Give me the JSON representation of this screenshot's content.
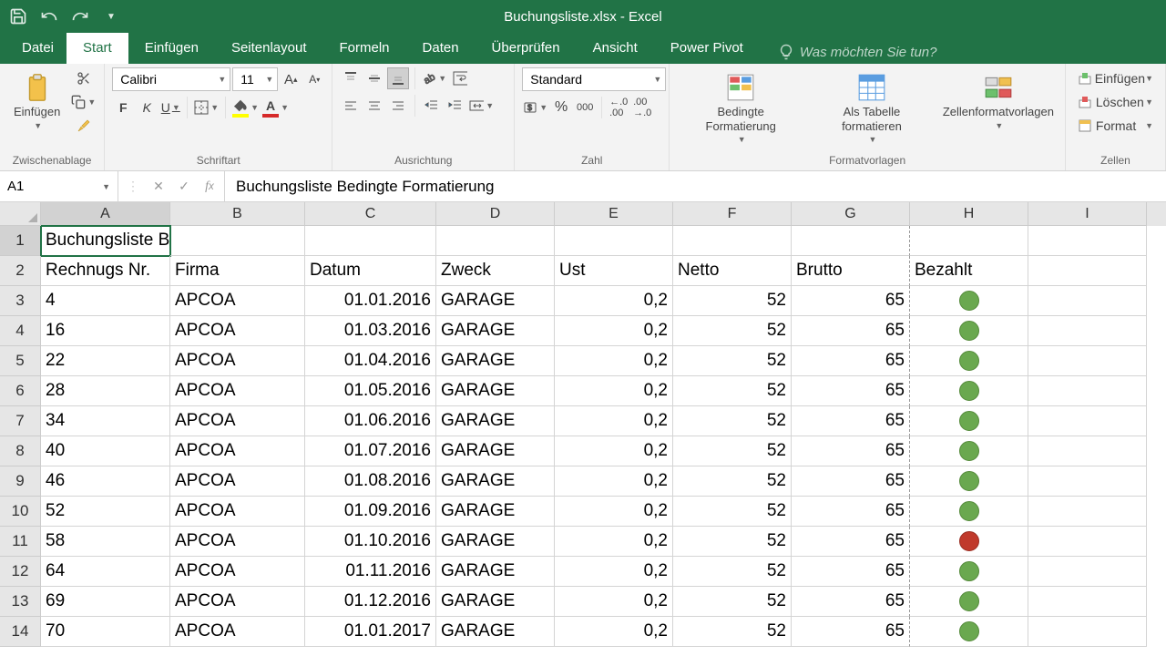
{
  "titlebar": {
    "title": "Buchungsliste.xlsx - Excel"
  },
  "tabs": {
    "file": "Datei",
    "home": "Start",
    "insert": "Einfügen",
    "page_layout": "Seitenlayout",
    "formulas": "Formeln",
    "data": "Daten",
    "review": "Überprüfen",
    "view": "Ansicht",
    "power_pivot": "Power Pivot",
    "tell_me": "Was möchten Sie tun?"
  },
  "ribbon": {
    "clipboard": {
      "label": "Zwischenablage",
      "paste": "Einfügen"
    },
    "font": {
      "label": "Schriftart",
      "name": "Calibri",
      "size": "11",
      "bold": "F",
      "italic": "K",
      "underline": "U"
    },
    "alignment": {
      "label": "Ausrichtung"
    },
    "number": {
      "label": "Zahl",
      "format": "Standard",
      "percent": "%",
      "thousand": "000"
    },
    "styles": {
      "label": "Formatvorlagen",
      "cond": "Bedingte Formatierung",
      "table": "Als Tabelle formatieren",
      "cell": "Zellenformatvorlagen"
    },
    "cells": {
      "label": "Zellen",
      "insert": "Einfügen",
      "delete": "Löschen",
      "format": "Format"
    }
  },
  "formula_bar": {
    "ref": "A1",
    "value": "Buchungsliste Bedingte Formatierung"
  },
  "columns": [
    "A",
    "B",
    "C",
    "D",
    "E",
    "F",
    "G",
    "H",
    "I"
  ],
  "headers": {
    "title": "Buchungsliste Bedingte Formatierung",
    "h": [
      "Rechnugs Nr.",
      "Firma",
      "Datum",
      "Zweck",
      "Ust",
      "Netto",
      "Brutto",
      "Bezahlt"
    ]
  },
  "rows": [
    {
      "nr": "4",
      "firma": "APCOA",
      "datum": "01.01.2016",
      "zweck": "GARAGE",
      "ust": "0,2",
      "netto": "52",
      "brutto": "65",
      "paid": "green"
    },
    {
      "nr": "16",
      "firma": "APCOA",
      "datum": "01.03.2016",
      "zweck": "GARAGE",
      "ust": "0,2",
      "netto": "52",
      "brutto": "65",
      "paid": "green"
    },
    {
      "nr": "22",
      "firma": "APCOA",
      "datum": "01.04.2016",
      "zweck": "GARAGE",
      "ust": "0,2",
      "netto": "52",
      "brutto": "65",
      "paid": "green"
    },
    {
      "nr": "28",
      "firma": "APCOA",
      "datum": "01.05.2016",
      "zweck": "GARAGE",
      "ust": "0,2",
      "netto": "52",
      "brutto": "65",
      "paid": "green"
    },
    {
      "nr": "34",
      "firma": "APCOA",
      "datum": "01.06.2016",
      "zweck": "GARAGE",
      "ust": "0,2",
      "netto": "52",
      "brutto": "65",
      "paid": "green"
    },
    {
      "nr": "40",
      "firma": "APCOA",
      "datum": "01.07.2016",
      "zweck": "GARAGE",
      "ust": "0,2",
      "netto": "52",
      "brutto": "65",
      "paid": "green"
    },
    {
      "nr": "46",
      "firma": "APCOA",
      "datum": "01.08.2016",
      "zweck": "GARAGE",
      "ust": "0,2",
      "netto": "52",
      "brutto": "65",
      "paid": "green"
    },
    {
      "nr": "52",
      "firma": "APCOA",
      "datum": "01.09.2016",
      "zweck": "GARAGE",
      "ust": "0,2",
      "netto": "52",
      "brutto": "65",
      "paid": "green"
    },
    {
      "nr": "58",
      "firma": "APCOA",
      "datum": "01.10.2016",
      "zweck": "GARAGE",
      "ust": "0,2",
      "netto": "52",
      "brutto": "65",
      "paid": "red"
    },
    {
      "nr": "64",
      "firma": "APCOA",
      "datum": "01.11.2016",
      "zweck": "GARAGE",
      "ust": "0,2",
      "netto": "52",
      "brutto": "65",
      "paid": "green"
    },
    {
      "nr": "69",
      "firma": "APCOA",
      "datum": "01.12.2016",
      "zweck": "GARAGE",
      "ust": "0,2",
      "netto": "52",
      "brutto": "65",
      "paid": "green"
    },
    {
      "nr": "70",
      "firma": "APCOA",
      "datum": "01.01.2017",
      "zweck": "GARAGE",
      "ust": "0,2",
      "netto": "52",
      "brutto": "65",
      "paid": "green"
    }
  ]
}
